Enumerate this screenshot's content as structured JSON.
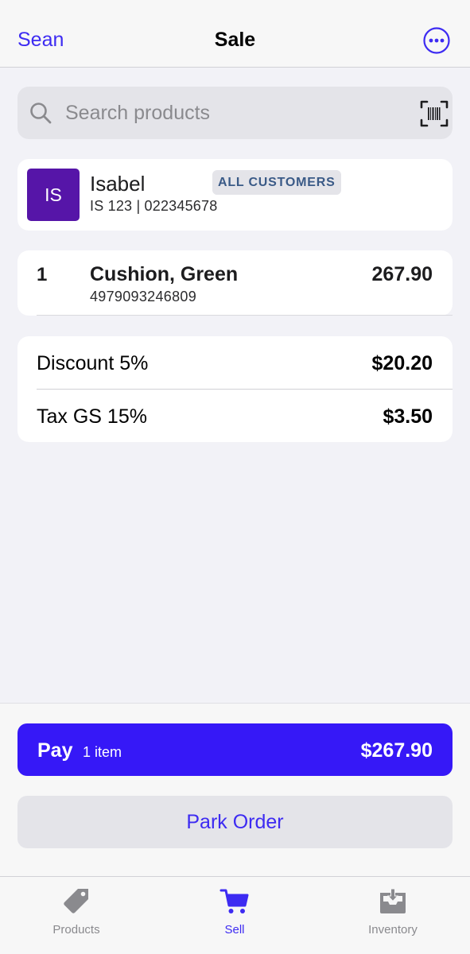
{
  "nav": {
    "user": "Sean",
    "title": "Sale",
    "more_icon": "ellipsis-circle-icon"
  },
  "search": {
    "placeholder": "Search products",
    "value": "",
    "search_icon": "magnifier-icon",
    "scan_icon": "barcode-scan-icon"
  },
  "customer": {
    "initials": "IS",
    "name": "Isabel",
    "meta": "IS 123 | 022345678",
    "group_badge": "ALL CUSTOMERS",
    "avatar_color": "#5615a8"
  },
  "line_items": [
    {
      "qty": "1",
      "name": "Cushion, Green",
      "sku": "4979093246809",
      "price": "267.90"
    }
  ],
  "adjustments": [
    {
      "label": "Discount 5%",
      "value": "$20.20"
    },
    {
      "label": "Tax GS 15%",
      "value": "$3.50"
    }
  ],
  "pay": {
    "label": "Pay",
    "count": "1 item",
    "amount": "$267.90"
  },
  "park": {
    "label": "Park Order"
  },
  "tabs": [
    {
      "label": "Products",
      "icon": "price-tag-icon",
      "active": false
    },
    {
      "label": "Sell",
      "icon": "shopping-cart-icon",
      "active": true
    },
    {
      "label": "Inventory",
      "icon": "inbox-download-icon",
      "active": false
    }
  ],
  "colors": {
    "accent": "#3d2bf2",
    "pay_button": "#3618f7",
    "background": "#f2f2f7",
    "inactive_tab": "#8a8a8e"
  }
}
